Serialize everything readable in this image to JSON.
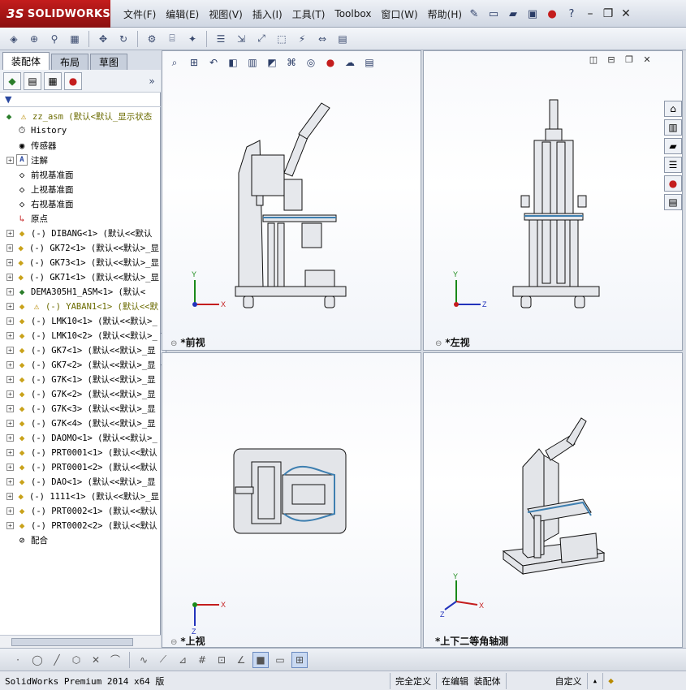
{
  "app": {
    "brand": "SOLIDWORKS",
    "brand_prefix": "3S"
  },
  "menus": [
    "文件(F)",
    "编辑(E)",
    "视图(V)",
    "插入(I)",
    "工具(T)",
    "Toolbox",
    "窗口(W)",
    "帮助(H)"
  ],
  "left_tabs": [
    "装配体",
    "布局",
    "草图"
  ],
  "tree": {
    "root": "zz_asm  (默认<默认_显示状态",
    "items": [
      {
        "label": "History",
        "icon": "history-icon",
        "expand": false
      },
      {
        "label": "传感器",
        "icon": "sensor-icon",
        "expand": false
      },
      {
        "label": "注解",
        "icon": "annotation-icon",
        "expand": true
      },
      {
        "label": "前视基准面",
        "icon": "plane-icon",
        "expand": false
      },
      {
        "label": "上视基准面",
        "icon": "plane-icon",
        "expand": false
      },
      {
        "label": "右视基准面",
        "icon": "plane-icon",
        "expand": false
      },
      {
        "label": "原点",
        "icon": "origin-icon",
        "expand": false
      },
      {
        "label": "(-) DIBANG<1> (默认<<默认",
        "icon": "part-icon",
        "expand": true
      },
      {
        "label": "(-) GK72<1> (默认<<默认>_显",
        "icon": "part-icon",
        "expand": true
      },
      {
        "label": "(-) GK73<1> (默认<<默认>_显",
        "icon": "part-icon",
        "expand": true
      },
      {
        "label": "(-) GK71<1> (默认<<默认>_显",
        "icon": "part-icon",
        "expand": true
      },
      {
        "label": "DEMA305H1_ASM<1> (默认<",
        "icon": "subasm-icon",
        "expand": true
      },
      {
        "label": "(-) YABAN1<1> (默认<<默",
        "icon": "part-icon",
        "expand": true,
        "warn": true
      },
      {
        "label": "(-) LMK10<1> (默认<<默认>_",
        "icon": "part-icon",
        "expand": true
      },
      {
        "label": "(-) LMK10<2> (默认<<默认>_",
        "icon": "part-icon",
        "expand": true
      },
      {
        "label": "(-) GK7<1> (默认<<默认>_显",
        "icon": "part-icon",
        "expand": true
      },
      {
        "label": "(-) GK7<2> (默认<<默认>_显",
        "icon": "part-icon",
        "expand": true
      },
      {
        "label": "(-) G7K<1> (默认<<默认>_显",
        "icon": "part-icon",
        "expand": true
      },
      {
        "label": "(-) G7K<2> (默认<<默认>_显",
        "icon": "part-icon",
        "expand": true
      },
      {
        "label": "(-) G7K<3> (默认<<默认>_显",
        "icon": "part-icon",
        "expand": true
      },
      {
        "label": "(-) G7K<4> (默认<<默认>_显",
        "icon": "part-icon",
        "expand": true
      },
      {
        "label": "(-) DAOMO<1> (默认<<默认>_",
        "icon": "part-icon",
        "expand": true
      },
      {
        "label": "(-) PRT0001<1> (默认<<默认",
        "icon": "part-icon",
        "expand": true
      },
      {
        "label": "(-) PRT0001<2> (默认<<默认",
        "icon": "part-icon",
        "expand": true
      },
      {
        "label": "(-) DAO<1> (默认<<默认>_显",
        "icon": "part-icon",
        "expand": true
      },
      {
        "label": "(-) 1111<1> (默认<<默认>_显",
        "icon": "part-icon",
        "expand": true
      },
      {
        "label": "(-) PRT0002<1> (默认<<默认",
        "icon": "part-icon",
        "expand": true
      },
      {
        "label": "(-) PRT0002<2> (默认<<默认",
        "icon": "part-icon",
        "expand": true
      },
      {
        "label": "配合",
        "icon": "mates-icon",
        "expand": false
      }
    ]
  },
  "viewports": [
    {
      "label": "*前视",
      "axis_h": "X",
      "axis_v": "Y"
    },
    {
      "label": "*左视",
      "axis_h": "Z",
      "axis_v": "Y"
    },
    {
      "label": "*上视",
      "axis_h": "X",
      "axis_v": "Z"
    },
    {
      "label": "*上下二等角轴测",
      "axis_h": "X",
      "axis_v": "Y",
      "axis_d": "Z"
    }
  ],
  "status": {
    "app_version": "SolidWorks Premium 2014 x64 版",
    "definition": "完全定义",
    "mode": "在编辑 装配体",
    "units": "自定义"
  }
}
